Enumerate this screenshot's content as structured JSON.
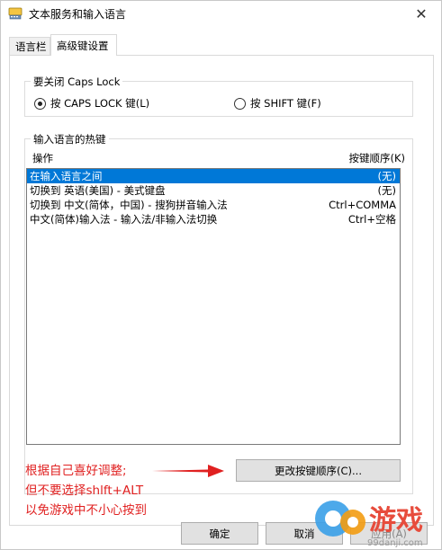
{
  "window": {
    "title": "文本服务和输入语言"
  },
  "tabs": [
    {
      "label": "语言栏",
      "active": false
    },
    {
      "label": "高级键设置",
      "active": true
    }
  ],
  "caps_group": {
    "label": "要关闭 Caps Lock",
    "option_capslock": {
      "label": "按 CAPS LOCK 键(L)",
      "checked": true
    },
    "option_shift": {
      "label": "按 SHIFT 键(F)",
      "checked": false
    }
  },
  "hotkey_group": {
    "label": "输入语言的热键",
    "col_action": "操作",
    "col_key": "按键顺序(K)",
    "rows": [
      {
        "action": "在输入语言之间",
        "key": "(无)",
        "selected": true
      },
      {
        "action": "切换到 英语(美国) - 美式键盘",
        "key": "(无)",
        "selected": false
      },
      {
        "action": "切换到 中文(简体，中国) - 搜狗拼音输入法",
        "key": "Ctrl+COMMA",
        "selected": false
      },
      {
        "action": "中文(简体)输入法 - 输入法/非输入法切换",
        "key": "Ctrl+空格",
        "selected": false
      }
    ],
    "change_button": "更改按键顺序(C)..."
  },
  "annotation": {
    "line1": "根据自己喜好调整;",
    "line2": "但不要选择shlft+ALT",
    "line3": "以免游戏中不小心按到",
    "color": "#e02020"
  },
  "footer": {
    "ok": "确定",
    "cancel": "取消",
    "apply": "应用(A)"
  },
  "watermark": {
    "text": "游戏",
    "site": "99danji.com"
  },
  "colors": {
    "selection": "#0078d7",
    "accent": "#0078d7"
  }
}
